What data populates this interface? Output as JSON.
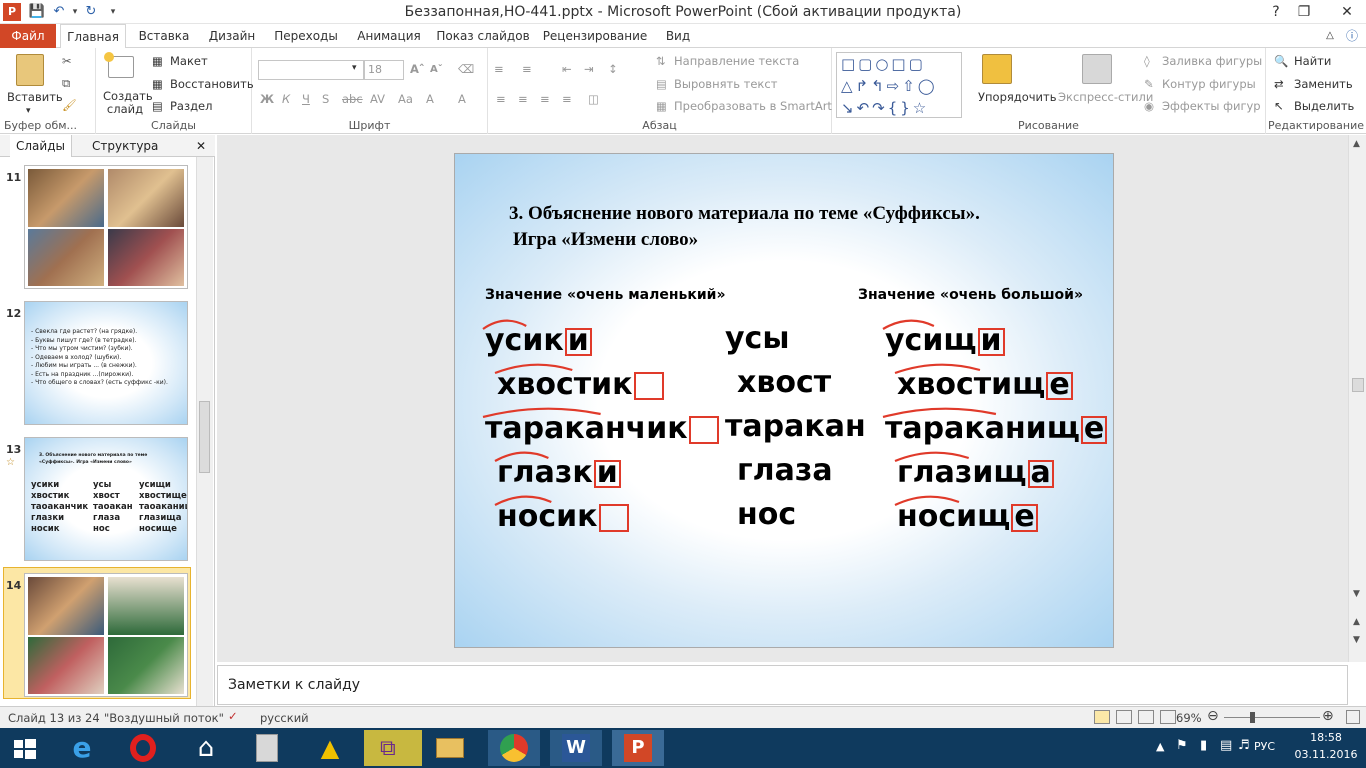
{
  "window": {
    "title": "Беззапонная,НО-441.pptx - Microsoft PowerPoint (Сбой активации продукта)",
    "app_icon": "P"
  },
  "tabs": [
    "Файл",
    "Главная",
    "Вставка",
    "Дизайн",
    "Переходы",
    "Анимация",
    "Показ слайдов",
    "Рецензирование",
    "Вид"
  ],
  "active_tab": "Главная",
  "ribbon": {
    "clipboard": {
      "paste": "Вставить",
      "label": "Буфер обм..."
    },
    "slides": {
      "new_slide": "Создать слайд",
      "layout": "Макет",
      "reset": "Восстановить",
      "section": "Раздел",
      "label": "Слайды"
    },
    "font": {
      "size": "18",
      "label": "Шрифт"
    },
    "paragraph": {
      "text_direction": "Направление текста",
      "align_text": "Выровнять текст",
      "smartart": "Преобразовать в SmartArt",
      "label": "Абзац"
    },
    "drawing": {
      "arrange": "Упорядочить",
      "quick_styles": "Экспресс-стили",
      "fill": "Заливка фигуры",
      "outline": "Контур фигуры",
      "effects": "Эффекты фигур",
      "label": "Рисование"
    },
    "editing": {
      "find": "Найти",
      "replace": "Заменить",
      "select": "Выделить",
      "label": "Редактирование"
    }
  },
  "left_panel": {
    "tab_slides": "Слайды",
    "tab_outline": "Структура",
    "thumb_numbers": [
      "11",
      "12",
      "13",
      "14"
    ],
    "slide12_lines": [
      "- Свекла где растет? (на грядке).",
      "- Буквы пишут где? (в тетрадке).",
      "- Что мы утром чистим? (зубки).",
      "- Одеваем в холод? (шубки).",
      "- Любим мы играть ... (в снежки).",
      "- Есть на праздник ...(пирожки).",
      "- Что общего в словах? (есть суффикс -ки)."
    ],
    "slide13_title": "3. Объяснение нового материала по теме «Суффиксы». Игра «Измени слово»",
    "slide13_col1": [
      "усики",
      "хвостик",
      "таоаканчик",
      "глазки",
      "носик"
    ],
    "slide13_col2": [
      "усы",
      "хвост",
      "таоакан",
      "глаза",
      "нос"
    ],
    "slide13_col3": [
      "усищи",
      "хвостище",
      "таоаканище",
      "глазища",
      "носище"
    ]
  },
  "slide": {
    "title_line1": "3. Объяснение нового материала по теме «Суффиксы».",
    "title_line2": "Игра «Измени слово»",
    "header_left": "Значение «очень маленький»",
    "header_right": "Значение «очень большой»",
    "col_left": [
      {
        "stem": "усик",
        "suffix": "и"
      },
      {
        "stem": "хвостик",
        "suffix": ""
      },
      {
        "stem": "тараканчик",
        "suffix": ""
      },
      {
        "stem": "глазк",
        "suffix": "и"
      },
      {
        "stem": "носик",
        "suffix": ""
      }
    ],
    "col_mid": [
      "усы",
      "хвост",
      "таракан",
      "глаза",
      "нос"
    ],
    "col_right": [
      {
        "stem": "усищ",
        "suffix": "и"
      },
      {
        "stem": "хвостищ",
        "suffix": "е"
      },
      {
        "stem": "тараканищ",
        "suffix": "е"
      },
      {
        "stem": "глазищ",
        "suffix": "а"
      },
      {
        "stem": "носищ",
        "suffix": "е"
      }
    ],
    "accent_color": "#e03a2a"
  },
  "notes": {
    "placeholder": "Заметки к слайду"
  },
  "status": {
    "slide_info": "Слайд 13 из 24",
    "theme": "\"Воздушный поток\"",
    "language": "русский",
    "zoom": "69%"
  },
  "taskbar": {
    "language": "РУС",
    "time": "18:58",
    "date": "03.11.2016"
  }
}
